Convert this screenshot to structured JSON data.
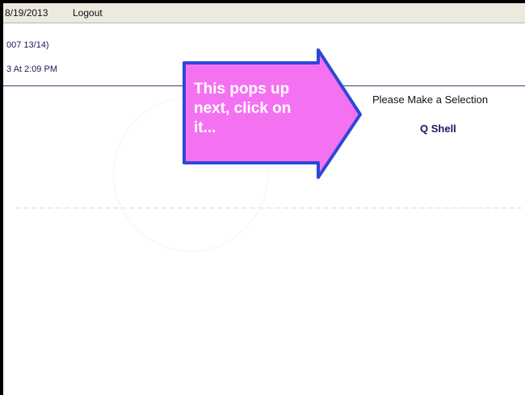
{
  "header": {
    "date": "8/19/2013",
    "logout_label": "Logout"
  },
  "info": {
    "line1": "007 13/14)",
    "line2": "3 At 2:09 PM"
  },
  "selection": {
    "prompt": "Please Make a Selection",
    "option_label": "Q Shell"
  },
  "callout": {
    "text": "This pops up\nnext, click on\nit...",
    "fill_color": "#f472f2",
    "border_color": "#2f47d6"
  }
}
